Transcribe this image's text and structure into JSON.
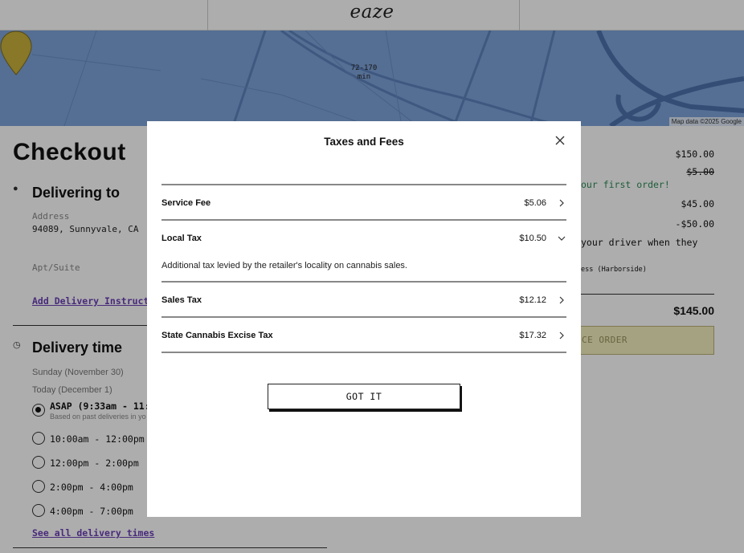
{
  "header": {
    "logo": "eaze"
  },
  "map": {
    "pin_line1": "72-170",
    "pin_line2": "min",
    "credit": "Map data ©2025 Google"
  },
  "checkout": {
    "title": "Checkout",
    "delivering": {
      "heading": "Delivering to",
      "address_label": "Address",
      "address_value": "94089, Sunnyvale, CA",
      "apt_placeholder": "Apt/Suite",
      "instructions_link": "Add Delivery Instruct"
    },
    "delivery_time": {
      "heading": "Delivery time",
      "day1": "Sunday (November 30)",
      "day2": "Today (December 1)",
      "slots": [
        {
          "label": "ASAP (9:33am - 11:",
          "sub": "Based on past deliveries in yo",
          "selected": true
        },
        {
          "label": "10:00am - 12:00pm",
          "selected": false
        },
        {
          "label": "12:00pm - 2:00pm",
          "selected": false
        },
        {
          "label": "2:00pm - 4:00pm",
          "selected": false
        },
        {
          "label": "4:00pm - 7:00pm",
          "selected": false
        }
      ],
      "see_all": "See all delivery times"
    }
  },
  "summary": {
    "subtotal": "$150.00",
    "delivery_struck": "$5.00",
    "first_order_note": "our first order!",
    "taxes_fees": "$45.00",
    "discount": "-$50.00",
    "driver_note": "your driver when they",
    "dispensary": "ess (Harborside)",
    "total": "$145.00",
    "place_order": "CE ORDER"
  },
  "modal": {
    "title": "Taxes and Fees",
    "rows": [
      {
        "label": "Service Fee",
        "value": "$5.06",
        "expanded": false
      },
      {
        "label": "Local Tax",
        "value": "$10.50",
        "expanded": true,
        "description": "Additional tax levied by the retailer's locality on cannabis sales."
      },
      {
        "label": "Sales Tax",
        "value": "$12.12",
        "expanded": false
      },
      {
        "label": "State Cannabis Excise Tax",
        "value": "$17.32",
        "expanded": false
      }
    ],
    "got_it": "GOT IT"
  },
  "colors": {
    "map_blue": "#7ea2d9",
    "pin_yellow": "#c9b23a",
    "link_purple": "#6a3fb5",
    "place_order_bg": "#f4efbf"
  }
}
